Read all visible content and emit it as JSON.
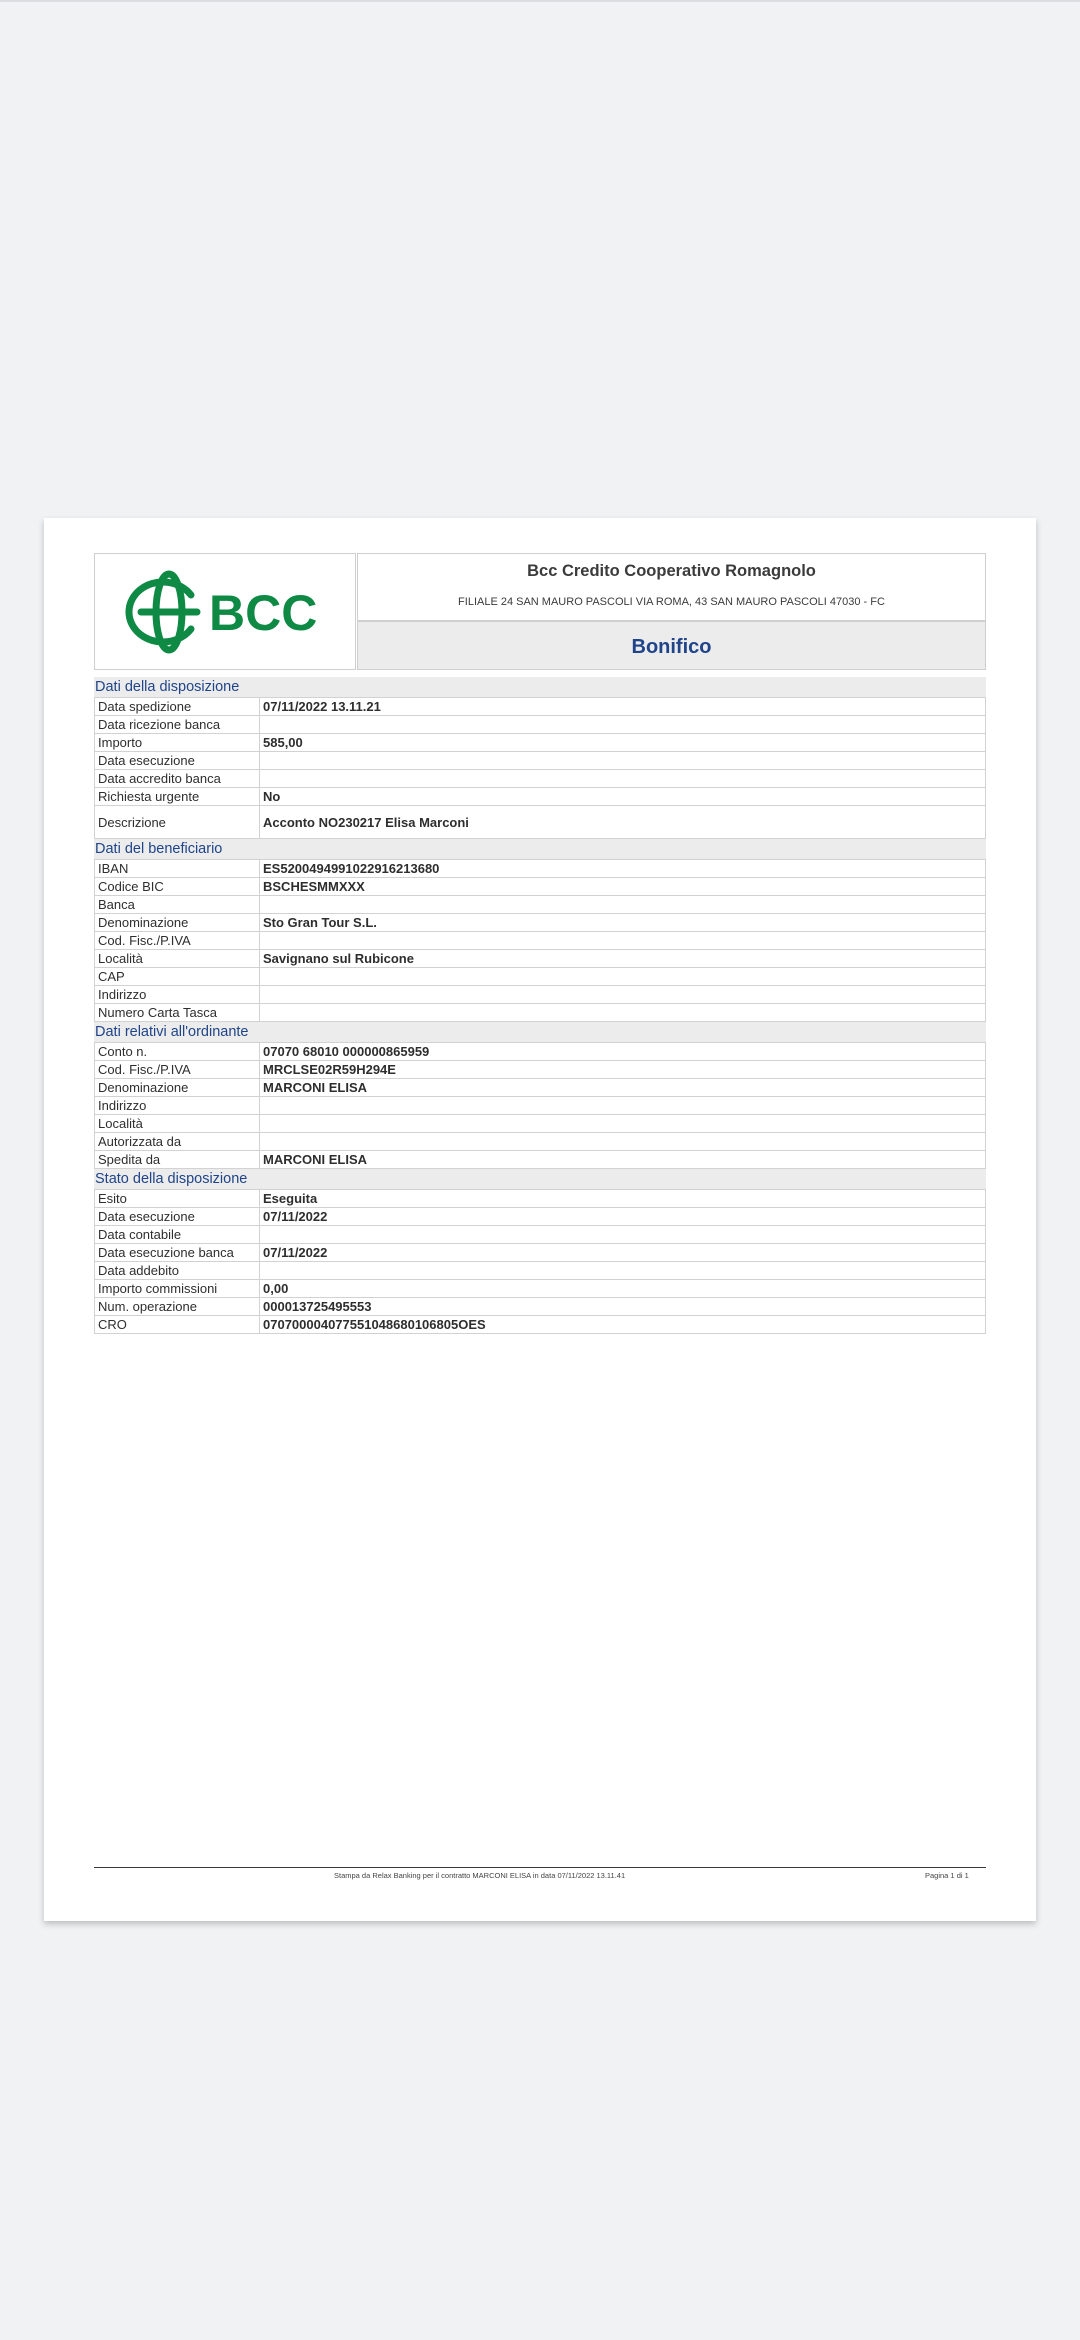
{
  "brand": {
    "logo_text": "BCC",
    "logo_color": "#0e8a45",
    "bank_name": "Bcc Credito Cooperativo Romagnolo",
    "address": "FILIALE 24 SAN MAURO PASCOLI VIA ROMA, 43 SAN MAURO PASCOLI 47030 - FC"
  },
  "document": {
    "title": "Bonifico",
    "title_color": "#1f4489"
  },
  "sections": [
    {
      "title": "Dati della disposizione",
      "rows": [
        {
          "label": "Data spedizione",
          "value": "07/11/2022 13.11.21"
        },
        {
          "label": "Data ricezione banca",
          "value": ""
        },
        {
          "label": "Importo",
          "value": "585,00"
        },
        {
          "label": "Data esecuzione",
          "value": ""
        },
        {
          "label": "Data accredito banca",
          "value": ""
        },
        {
          "label": "Richiesta urgente",
          "value": "No"
        },
        {
          "label": "Descrizione",
          "value": "Acconto  NO230217 Elisa Marconi",
          "tall": true
        }
      ]
    },
    {
      "title": "Dati del beneficiario",
      "rows": [
        {
          "label": "IBAN",
          "value": "ES5200494991022916213680"
        },
        {
          "label": "Codice BIC",
          "value": "BSCHESMMXXX"
        },
        {
          "label": "Banca",
          "value": ""
        },
        {
          "label": "Denominazione",
          "value": "Sto Gran Tour S.L."
        },
        {
          "label": "Cod. Fisc./P.IVA",
          "value": ""
        },
        {
          "label": "Località",
          "value": "Savignano sul Rubicone"
        },
        {
          "label": "CAP",
          "value": ""
        },
        {
          "label": "Indirizzo",
          "value": ""
        },
        {
          "label": "Numero Carta Tasca",
          "value": ""
        }
      ]
    },
    {
      "title": "Dati relativi all'ordinante",
      "rows": [
        {
          "label": "Conto n.",
          "value": "07070 68010 000000865959"
        },
        {
          "label": "Cod. Fisc./P.IVA",
          "value": "MRCLSE02R59H294E"
        },
        {
          "label": "Denominazione",
          "value": "MARCONI ELISA"
        },
        {
          "label": "Indirizzo",
          "value": ""
        },
        {
          "label": "Località",
          "value": ""
        },
        {
          "label": "Autorizzata da",
          "value": ""
        },
        {
          "label": "Spedita da",
          "value": "MARCONI ELISA"
        }
      ]
    },
    {
      "title": "Stato della disposizione",
      "rows": [
        {
          "label": "Esito",
          "value": "Eseguita"
        },
        {
          "label": "Data esecuzione",
          "value": "07/11/2022"
        },
        {
          "label": "Data contabile",
          "value": ""
        },
        {
          "label": "Data esecuzione banca",
          "value": "07/11/2022"
        },
        {
          "label": "Data addebito",
          "value": ""
        },
        {
          "label": "Importo commissioni",
          "value": "0,00"
        },
        {
          "label": "Num. operazione",
          "value": "000013725495553"
        },
        {
          "label": "CRO",
          "value": "070700004077551048680106805OES"
        }
      ]
    }
  ],
  "footer": {
    "print_note": "Stampa da Relax Banking per il contratto  MARCONI ELISA in data 07/11/2022 13.11.41",
    "page_label": "Pagina 1 di    1"
  }
}
